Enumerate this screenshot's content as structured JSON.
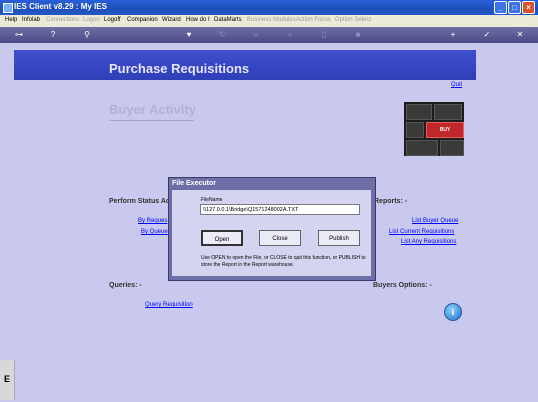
{
  "window": {
    "title": "IES Client v8.29 : My IES"
  },
  "menu": [
    {
      "label": "Help",
      "enabled": true
    },
    {
      "label": "Infolab",
      "enabled": true
    },
    {
      "label": "Connections",
      "enabled": false
    },
    {
      "label": "Logon",
      "enabled": false
    },
    {
      "label": "Logoff",
      "enabled": true
    },
    {
      "label": "Companion",
      "enabled": true
    },
    {
      "label": "Wizard",
      "enabled": true
    },
    {
      "label": "How do I",
      "enabled": true
    },
    {
      "label": "DataMarts",
      "enabled": true
    },
    {
      "label": "Business Modules",
      "enabled": false
    },
    {
      "label": "Action Focus",
      "enabled": false
    },
    {
      "label": "Option Select",
      "enabled": false
    }
  ],
  "page": {
    "title": "Purchase Requisitions",
    "quit_link": "Quit",
    "section_title": "Buyer Activity",
    "image_caption": "BUY"
  },
  "left_panel": {
    "status_heading": "Perform Status Ac",
    "links": [
      "By Reques",
      "By Queue"
    ],
    "queries_heading": "Queries: -",
    "query_link": "Query Requisition"
  },
  "right_panel": {
    "reports_heading": "Reports: -",
    "links": [
      "List Buyer Queue",
      "List Current Requisitions",
      "List Any Requisitions"
    ],
    "buyers_heading": "Buyers Options: -"
  },
  "dialog": {
    "title": "File Executor",
    "field_label": "FileName",
    "field_value": "\\\\127.0.0.1\\Bridge\\Q1571248002A.TXT",
    "buttons": {
      "open": "Open",
      "close": "Close",
      "publish": "Publish"
    },
    "note": "Use OPEN to open the File, or CLOSE to quit this function, or PUBLISH to store the Report in the Report warehouse."
  },
  "sidebar_letter": "E",
  "colors": {
    "banner": "#3f4fd0",
    "background": "#c9c9ef",
    "link": "#0000ff"
  }
}
